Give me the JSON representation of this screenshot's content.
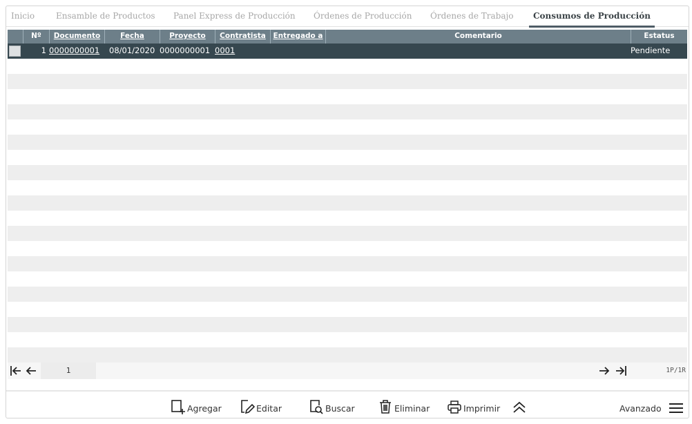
{
  "tabs": [
    {
      "label": "Inicio"
    },
    {
      "label": "Ensamble de Productos"
    },
    {
      "label": "Panel Express de Producción"
    },
    {
      "label": "Órdenes de Producción"
    },
    {
      "label": "Órdenes de Trabajo"
    },
    {
      "label": "Consumos de Producción",
      "active": true
    }
  ],
  "grid": {
    "columns": {
      "num": "Nº",
      "documento": "Documento",
      "fecha": "Fecha",
      "proyecto": "Proyecto",
      "contratista": "Contratista",
      "entregado": "Entregado a",
      "comentario": "Comentario",
      "estatus": "Estatus"
    },
    "rows": [
      {
        "num": "1",
        "documento": "0000000001",
        "fecha": "08/01/2020",
        "proyecto": "0000000001",
        "contratista": "0001",
        "entregado": "",
        "comentario": "",
        "estatus": "Pendiente"
      }
    ]
  },
  "pager": {
    "page": "1",
    "info": "1P/1R"
  },
  "toolbar": {
    "agregar": "Agregar",
    "editar": "Editar",
    "buscar": "Buscar",
    "eliminar": "Eliminar",
    "imprimir": "Imprimir",
    "avanzado": "Avanzado"
  },
  "colors": {
    "header_bg": "#6d7f89",
    "selected_row_bg": "#36474f",
    "alt_row_bg": "#eeeeee",
    "active_tab_underline": "#4e5c66"
  }
}
